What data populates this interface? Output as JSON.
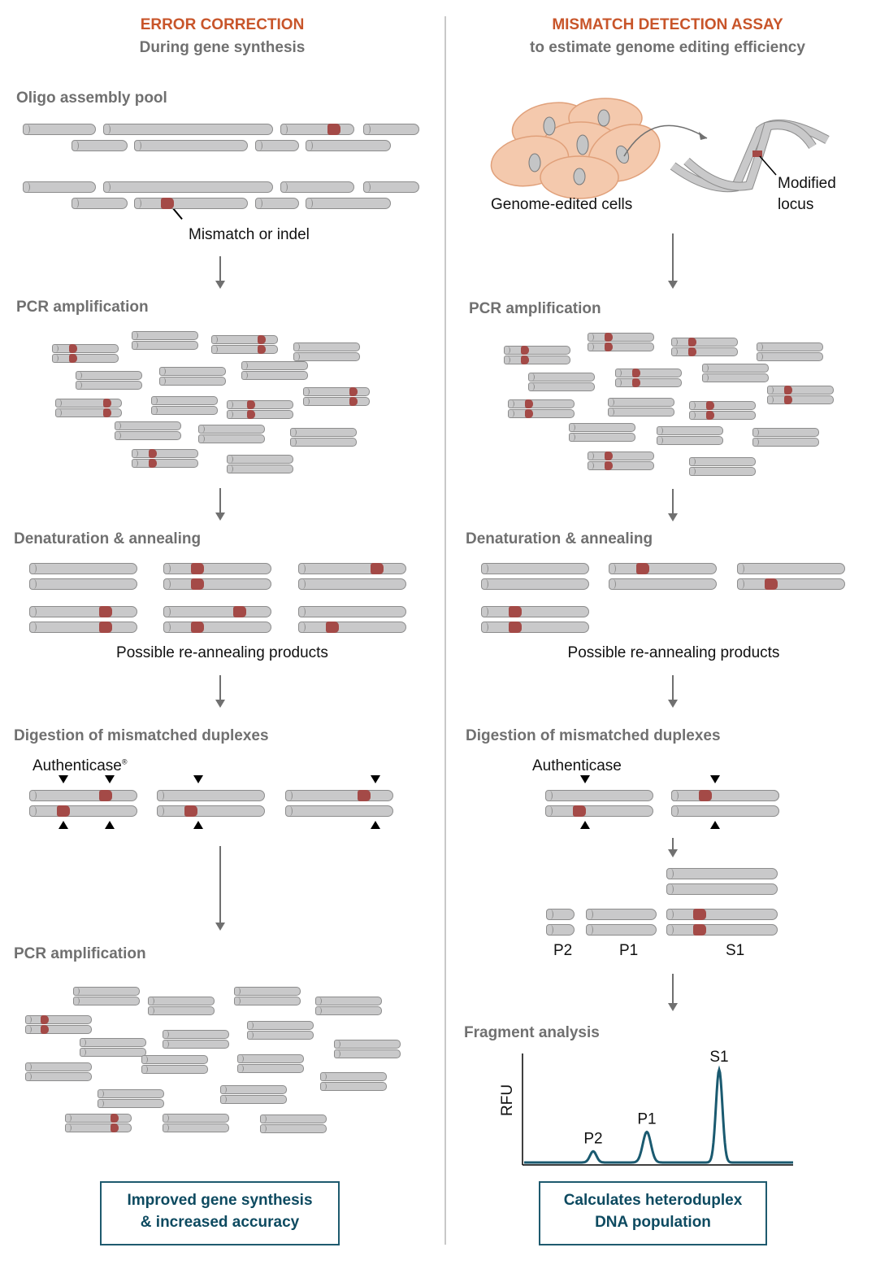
{
  "left_panel": {
    "title": "ERROR CORRECTION",
    "subtitle": "During gene synthesis",
    "steps": {
      "oligo_pool": "Oligo assembly pool",
      "pcr1": "PCR amplification",
      "denature": "Denaturation & annealing",
      "digestion": "Digestion of mismatched duplexes",
      "pcr2": "PCR amplification"
    },
    "mismatch_label": "Mismatch or indel",
    "reannealing_label": "Possible re-annealing products",
    "enzyme_label": "Authenticase",
    "enzyme_mark": "®",
    "result": [
      "Improved gene synthesis",
      "& increased accuracy"
    ]
  },
  "right_panel": {
    "title": "MISMATCH DETECTION ASSAY",
    "subtitle": "to estimate genome editing efficiency",
    "cells_label": "Genome-edited cells",
    "locus_label": [
      "Modified",
      "locus"
    ],
    "steps": {
      "pcr": "PCR amplification",
      "denature": "Denaturation & annealing",
      "digestion": "Digestion of mismatched duplexes",
      "fragment": "Fragment analysis"
    },
    "reannealing_label": "Possible re-annealing products",
    "enzyme_label": "Authenticase",
    "fragment_labels": [
      "P2",
      "P1",
      "S1"
    ],
    "result": [
      "Calculates heteroduplex",
      "DNA population"
    ]
  },
  "colors": {
    "title": "#c8552a",
    "step": "#707070",
    "strand": "#c9c9ca",
    "mutation": "#a44a47",
    "cell": "#f4c9ad",
    "trace": "#1a5a70",
    "result_text": "#0d4a60"
  },
  "chart_data": {
    "type": "line",
    "title": "Fragment analysis",
    "xlabel": "",
    "ylabel": "RFU",
    "peaks": [
      {
        "label": "P2",
        "relative_height": 0.12
      },
      {
        "label": "P1",
        "relative_height": 0.33
      },
      {
        "label": "S1",
        "relative_height": 1.0
      }
    ],
    "grid": false
  }
}
